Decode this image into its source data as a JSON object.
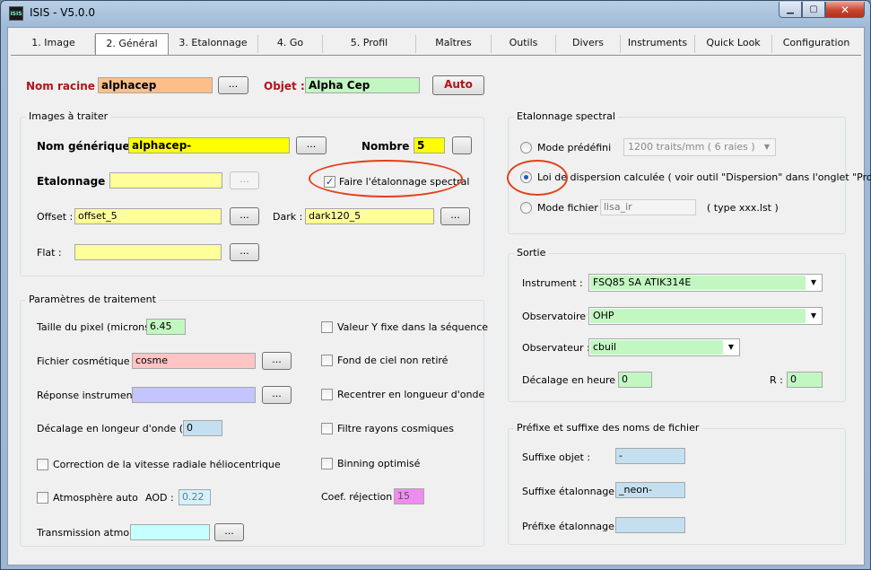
{
  "window": {
    "title": "ISIS - V5.0.0",
    "app_icon_text": "ISIS"
  },
  "tabs": [
    "1. Image",
    "2. Général",
    "3. Etalonnage",
    "4. Go",
    "5. Profil",
    "Maîtres",
    "Outils",
    "Divers",
    "Instruments",
    "Quick Look",
    "Configuration"
  ],
  "top": {
    "nom_racine_label": "Nom racine :",
    "nom_racine_value": "alphacep",
    "nom_racine_btn": "...",
    "objet_label": "Objet :",
    "objet_value": "Alpha Cep",
    "auto_btn": "Auto"
  },
  "images": {
    "title": "Images à traiter",
    "nom_generique_label": "Nom générique :",
    "nom_generique_value": "alphacep-",
    "nom_generique_btn": "...",
    "nombre_label": "Nombre :",
    "nombre_value": "5",
    "nombre_btn": "",
    "etalonnage_label": "Etalonnage :",
    "etalonnage_value": "",
    "etalonnage_btn": "...",
    "faire_etalonnage_label": "Faire l'étalonnage spectral",
    "faire_etalonnage_checked": true,
    "offset_label": "Offset :",
    "offset_value": "offset_5",
    "offset_btn": "...",
    "dark_label": "Dark :",
    "dark_value": "dark120_5",
    "dark_btn": "...",
    "flat_label": "Flat :",
    "flat_value": "",
    "flat_btn": "..."
  },
  "params": {
    "title": "Paramètres de traitement",
    "pixel_label": "Taille du pixel (microns) :",
    "pixel_value": "6.45",
    "cosmetique_label": "Fichier cosmétique :",
    "cosmetique_value": "cosme",
    "cosmetique_btn": "...",
    "reponse_label": "Réponse instrument :",
    "reponse_value": "",
    "reponse_btn": "...",
    "decalage_label": "Décalage en longeur d'onde (A) :",
    "decalage_value": "0",
    "correction_label": "Correction de la vitesse radiale héliocentrique",
    "atmosphere_label": "Atmosphère auto",
    "aod_label": "AOD :",
    "aod_value": "0.22",
    "transmission_label": "Transmission atmo. :",
    "transmission_value": "",
    "transmission_btn": "...",
    "valeur_y_label": "Valeur Y fixe dans la séquence",
    "fond_ciel_label": "Fond de ciel non retiré",
    "recentrer_label": "Recentrer en longueur d'onde",
    "filtre_label": "Filtre rayons cosmiques",
    "binning_label": "Binning optimisé",
    "coef_label": "Coef. réjection :",
    "coef_value": "15"
  },
  "etal_spectral": {
    "title": "Etalonnage spectral",
    "mode_predefini_label": "Mode prédéfini",
    "mode_predefini_value": "1200 traits/mm ( 6 raies )",
    "loi_label": "Loi de dispersion calculée ( voir outil \"Dispersion\" dans l'onglet \"Profil\" )",
    "mode_fichier_label": "Mode fichier :",
    "mode_fichier_value": "lisa_ir",
    "mode_fichier_hint": "( type xxx.lst )"
  },
  "sortie": {
    "title": "Sortie",
    "instrument_label": "Instrument :",
    "instrument_value": "FSQ85 SA ATIK314E",
    "observatoire_label": "Observatoire :",
    "observatoire_value": "OHP",
    "observateur_label": "Observateur :",
    "observateur_value": "cbuil",
    "decalage_heure_label": "Décalage en heure :",
    "decalage_heure_value": "0",
    "r_label": "R :",
    "r_value": "0"
  },
  "prefixe": {
    "title": "Préfixe et suffixe des noms de fichier",
    "suffixe_objet_label": "Suffixe objet :",
    "suffixe_objet_value": "-",
    "suffixe_etal_label": "Suffixe étalonnage :",
    "suffixe_etal_value": "_neon-",
    "prefixe_etal_label": "Préfixe étalonnage :",
    "prefixe_etal_value": ""
  },
  "colors": {
    "orange": "#fdbf8a",
    "green": "#c2f7c2",
    "yellow": "#ffff00",
    "light_yellow": "#ffff99",
    "pink": "#ffc4c4",
    "lavender": "#c4c4ff",
    "light_cyan": "#d2f2ff",
    "cyan": "#c6ffff",
    "magenta": "#ef8cef",
    "light_blue": "#c4e0f0"
  }
}
